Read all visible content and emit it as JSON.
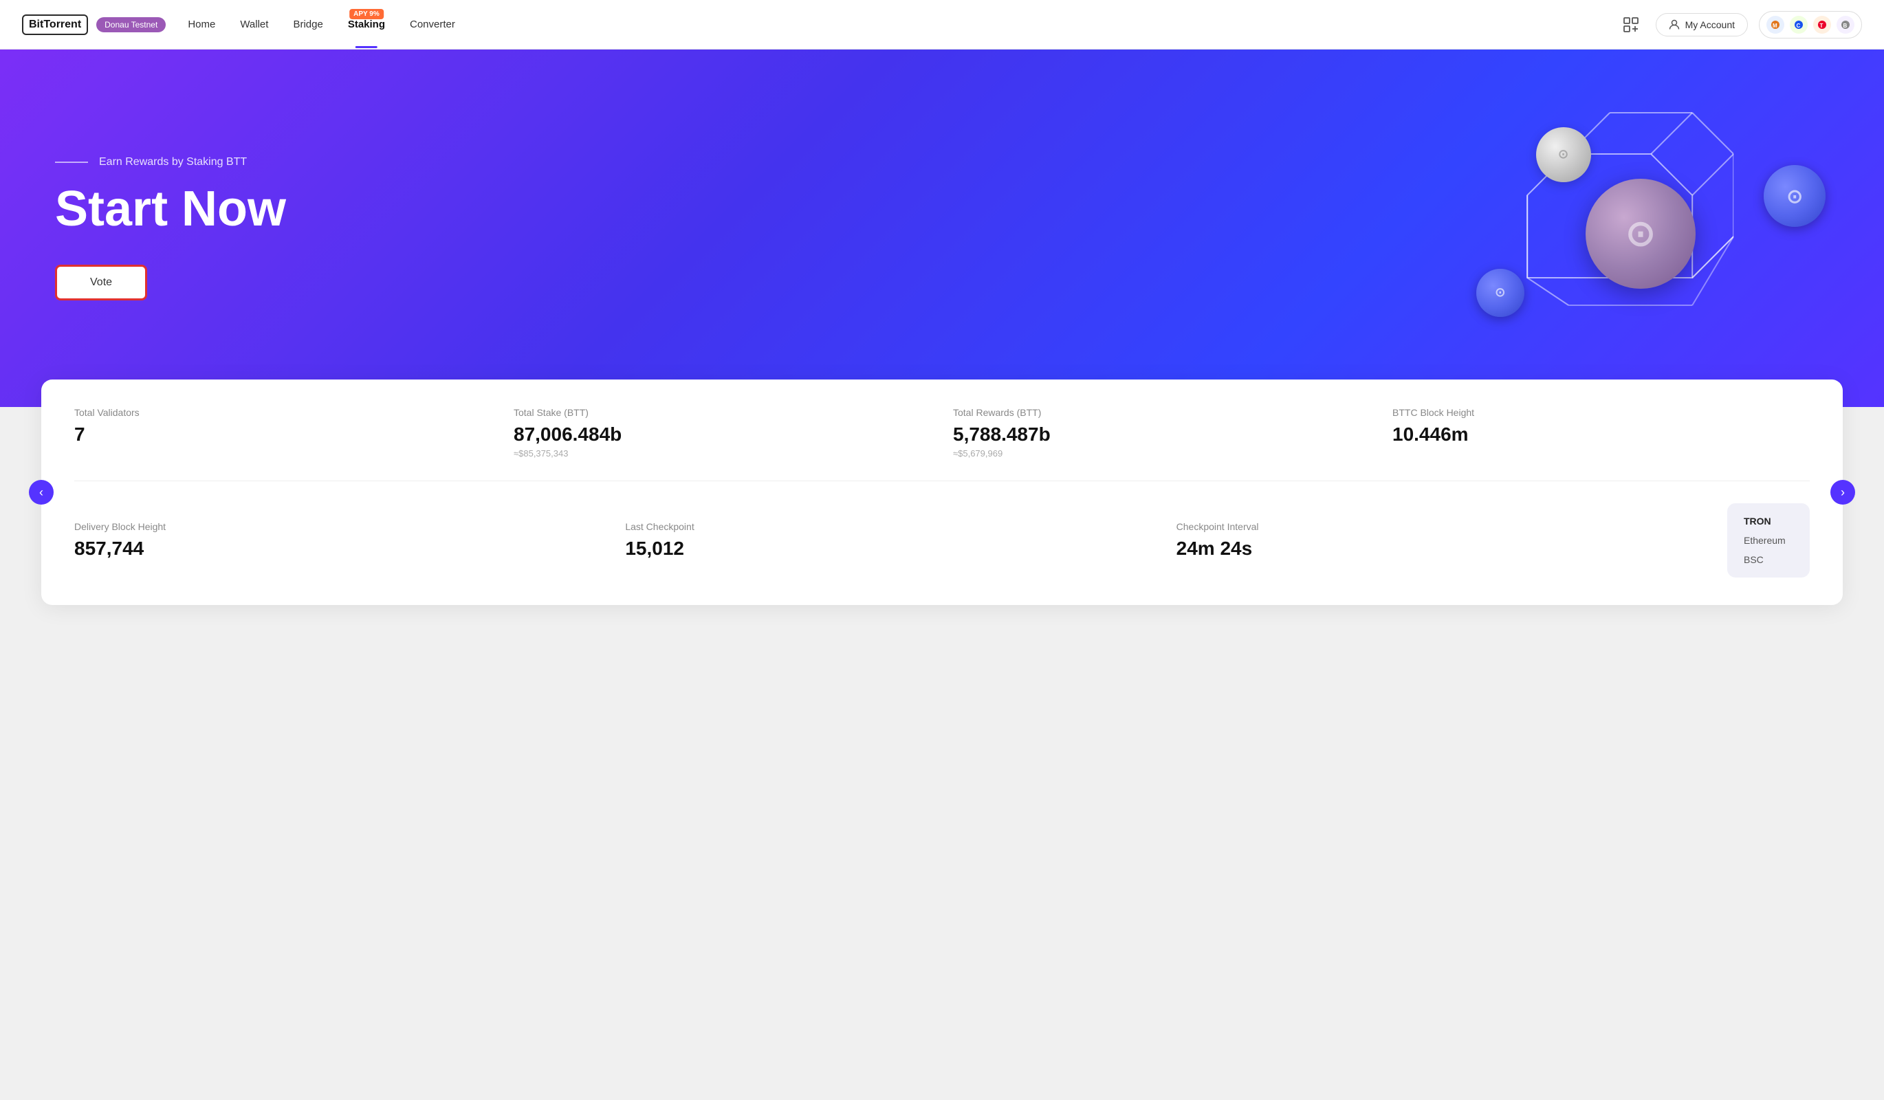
{
  "brand": {
    "name": "BitTorrent",
    "network": "Donau Testnet"
  },
  "nav": {
    "home_label": "Home",
    "wallet_label": "Wallet",
    "bridge_label": "Bridge",
    "staking_label": "Staking",
    "staking_apy": "APY 9%",
    "converter_label": "Converter",
    "my_account_label": "My Account",
    "active": "Staking"
  },
  "hero": {
    "subtitle": "Earn Rewards by Staking BTT",
    "title": "Start Now",
    "cta_label": "Vote"
  },
  "stats": {
    "top": [
      {
        "label": "Total Validators",
        "value": "7",
        "sub": ""
      },
      {
        "label": "Total Stake (BTT)",
        "value": "87,006.484b",
        "sub": "≈$85,375,343"
      },
      {
        "label": "Total Rewards (BTT)",
        "value": "5,788.487b",
        "sub": "≈$5,679,969"
      },
      {
        "label": "BTTC Block Height",
        "value": "10.446m",
        "sub": ""
      }
    ],
    "bottom": [
      {
        "label": "Delivery Block Height",
        "value": "857,744",
        "sub": ""
      },
      {
        "label": "Last Checkpoint",
        "value": "15,012",
        "sub": ""
      },
      {
        "label": "Checkpoint Interval",
        "value": "24m 24s",
        "sub": ""
      }
    ],
    "chains": [
      {
        "name": "TRON",
        "active": true
      },
      {
        "name": "Ethereum",
        "active": false
      },
      {
        "name": "BSC",
        "active": false
      }
    ]
  }
}
